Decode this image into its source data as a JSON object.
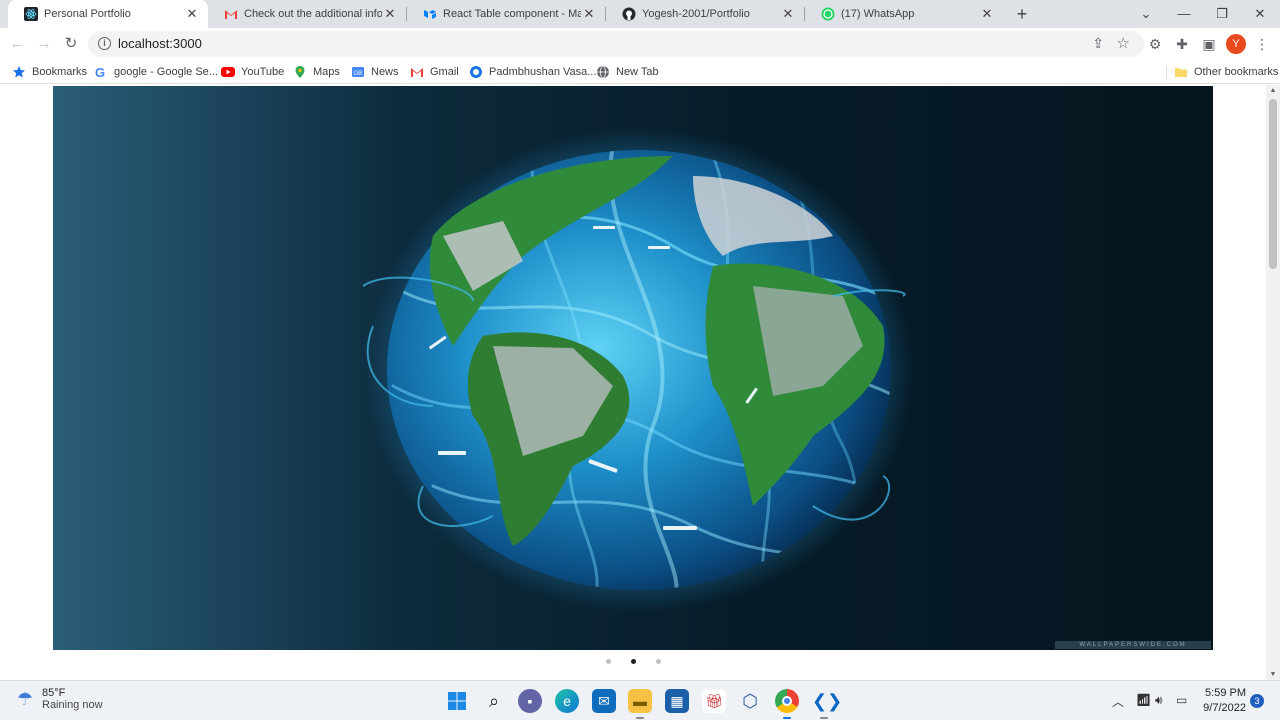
{
  "tabs": [
    {
      "title": "Personal Portfolio",
      "favicon": "react-icon",
      "active": true
    },
    {
      "title": "Check out the additional informa",
      "favicon": "gmail-icon"
    },
    {
      "title": "React Table component - Materia",
      "favicon": "mui-icon"
    },
    {
      "title": "Yogesh-2001/Portfolio",
      "favicon": "github-icon"
    },
    {
      "title": "(17) WhatsApp",
      "favicon": "whatsapp-icon"
    }
  ],
  "toolbar": {
    "url": "localhost:3000",
    "avatar_letter": "Y"
  },
  "bookmarks": {
    "items": [
      {
        "label": "Bookmarks",
        "icon": "star-icon"
      },
      {
        "label": "google - Google Se...",
        "icon": "google-icon"
      },
      {
        "label": "YouTube",
        "icon": "youtube-icon"
      },
      {
        "label": "Maps",
        "icon": "maps-icon"
      },
      {
        "label": "News",
        "icon": "news-icon"
      },
      {
        "label": "Gmail",
        "icon": "gmail-icon"
      },
      {
        "label": "Padmbhushan Vasa...",
        "icon": "site-icon"
      },
      {
        "label": "New Tab",
        "icon": "globe-icon"
      }
    ],
    "other": "Other bookmarks"
  },
  "carousel": {
    "slide_count": 3,
    "active_index": 1,
    "watermark": "WALLPAPERSWIDE.COM"
  },
  "taskbar": {
    "weather_temp": "85°F",
    "weather_condition": "Raining now",
    "time": "5:59 PM",
    "date": "9/7/2022",
    "notification_count": "3",
    "apps": [
      "windows-start-icon",
      "search-icon",
      "teams-chat-icon",
      "edge-icon",
      "mail-icon",
      "file-explorer-icon",
      "store-icon",
      "gift-icon",
      "virtualbox-icon",
      "chrome-icon",
      "vscode-icon"
    ]
  },
  "colors": {
    "accent": "#1a73e8",
    "avatar": "#e8491d",
    "tab_bg": "#dee1e6"
  }
}
